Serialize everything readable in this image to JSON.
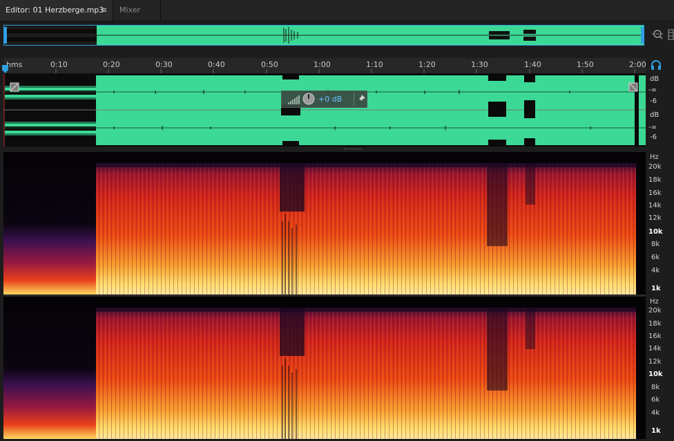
{
  "tabs": {
    "editor": "Editor: 01 Herzberge.mp3",
    "menu_icon": "≡",
    "mixer": "Mixer"
  },
  "ruler": {
    "unit": "hms",
    "ticks": [
      "0:10",
      "0:20",
      "0:30",
      "0:40",
      "0:50",
      "1:00",
      "1:10",
      "1:20",
      "1:30",
      "1:40",
      "1:50",
      "2:00"
    ]
  },
  "hud": {
    "volume_value": "+0 dB"
  },
  "level_axis": {
    "ch1": {
      "unit": "dB",
      "inf": "-∞",
      "six": "-6"
    },
    "ch2": {
      "unit": "dB",
      "inf": "-∞",
      "six": "-6"
    }
  },
  "freq_axis": {
    "unit": "Hz",
    "labels": [
      "20k",
      "18k",
      "16k",
      "14k",
      "12k",
      "10k",
      "8k",
      "6k",
      "4k",
      "1k"
    ]
  },
  "colors": {
    "waveform_bg": "#3cd996",
    "selection_border": "#2f9fe0",
    "accent_blue": "#6ec0ff"
  },
  "icons": {
    "zoom": "zoom-full-icon",
    "monitor": "headphones-icon",
    "pin": "pin-icon",
    "knob": "volume-knob-icon"
  }
}
